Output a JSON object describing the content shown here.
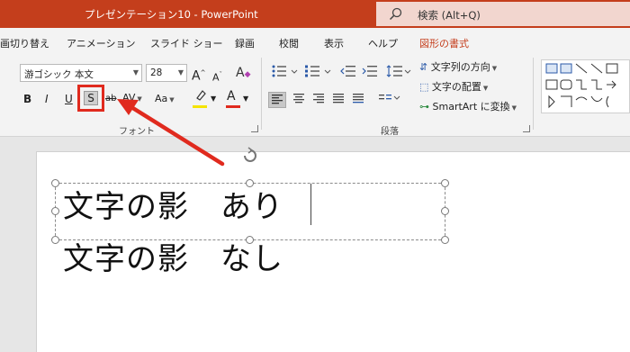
{
  "window": {
    "title": "プレゼンテーション10  -  PowerPoint",
    "search_label": "検索 (Alt+Q)"
  },
  "tabs": [
    {
      "label": "画切り替え"
    },
    {
      "label": "アニメーション"
    },
    {
      "label": "スライド ショー"
    },
    {
      "label": "録画"
    },
    {
      "label": "校閲"
    },
    {
      "label": "表示"
    },
    {
      "label": "ヘルプ"
    },
    {
      "label": "図形の書式"
    }
  ],
  "font_group": {
    "label": "フォント",
    "font_name": "游ゴシック 本文",
    "font_size": "28",
    "grow_label": "A",
    "shrink_label": "A",
    "clear_label": "A",
    "bold": "B",
    "italic": "I",
    "underline": "U",
    "shadow": "S",
    "strike": "ab",
    "spacing": "AV",
    "case": "Aa",
    "highlight_label": "",
    "font_color_label": "A",
    "highlight_color": "#f5e400",
    "font_color": "#e02a1e"
  },
  "paragraph_group": {
    "label": "段落",
    "text_direction": "文字列の方向",
    "text_align": "文字の配置",
    "smartart": "SmartArt に変換"
  },
  "slide": {
    "line1": "文字の影　あり",
    "line2": "文字の影　なし"
  },
  "colors": {
    "titlebar": "#c43e1c",
    "accent_red": "#e02a1e"
  }
}
